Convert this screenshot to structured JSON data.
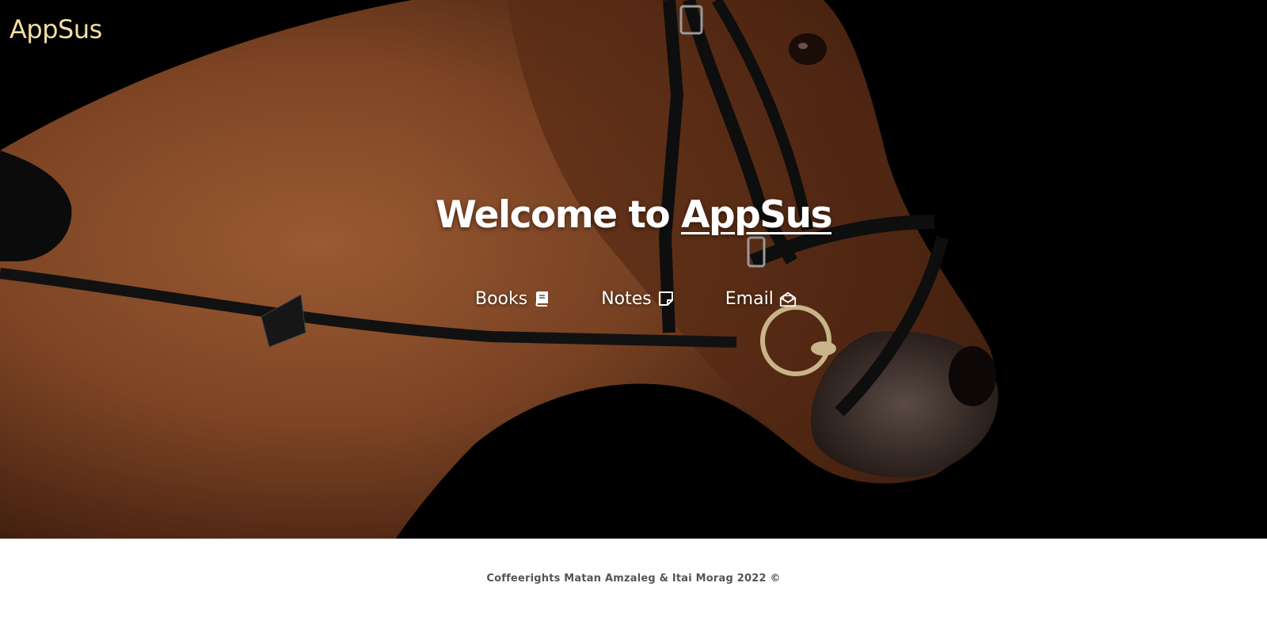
{
  "header": {
    "logo_text": "AppSus",
    "logo_color": "#f2dfa4"
  },
  "hero": {
    "image_description_icon": "horse-photo",
    "title_prefix": "Welcome to ",
    "title_brand": "AppSus",
    "title_color": "#ffffff"
  },
  "nav": {
    "items": [
      {
        "label": "Books",
        "icon": "book-icon"
      },
      {
        "label": "Notes",
        "icon": "note-icon"
      },
      {
        "label": "Email",
        "icon": "envelope-open-icon"
      }
    ]
  },
  "footer": {
    "text": "Coffeerights Matan Amzaleg & Itai Morag 2022 ©",
    "text_color": "#555555"
  }
}
